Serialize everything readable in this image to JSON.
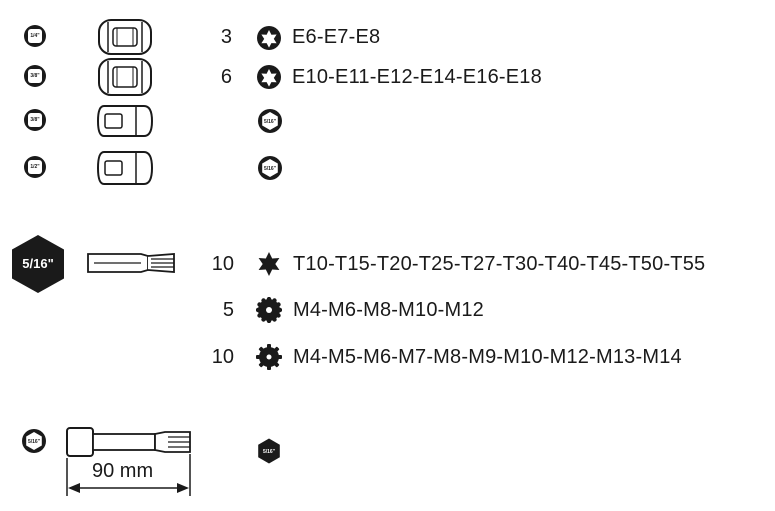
{
  "sockets": [
    {
      "drive_label": "1/4\"",
      "quantity": "3",
      "profile_icon": "torx-external-icon",
      "sizes": "E6-E7-E8"
    },
    {
      "drive_label": "3/8\"",
      "quantity": "6",
      "profile_icon": "torx-external-icon",
      "sizes": "E10-E11-E12-E14-E16-E18"
    },
    {
      "drive_label": "3/8\"",
      "quantity": "",
      "profile_icon": "hex-drive-icon",
      "hex_label": "5/16\"",
      "sizes": ""
    },
    {
      "drive_label": "1/2\"",
      "quantity": "",
      "profile_icon": "hex-drive-icon",
      "hex_label": "5/16\"",
      "sizes": ""
    }
  ],
  "bits": {
    "drive_label": "5/16\"",
    "rows": [
      {
        "quantity": "10",
        "profile_icon": "torx-icon",
        "sizes": "T10-T15-T20-T25-T27-T30-T40-T45-T50-T55"
      },
      {
        "quantity": "5",
        "profile_icon": "xzn-multipoint-icon",
        "sizes": "M4-M6-M8-M10-M12"
      },
      {
        "quantity": "10",
        "profile_icon": "spline-icon",
        "sizes": "M4-M5-M6-M7-M8-M9-M10-M12-M13-M14"
      }
    ]
  },
  "extension": {
    "drive_label": "5/16\"",
    "length_label": "90 mm",
    "output_label": "5/16\""
  },
  "colors": {
    "ink": "#1a1a1a",
    "background": "#ffffff"
  }
}
